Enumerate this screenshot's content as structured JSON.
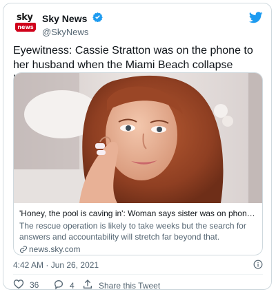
{
  "account": {
    "logo_top": "sky",
    "logo_bottom": "news",
    "display_name": "Sky News",
    "handle": "@SkyNews"
  },
  "tweet": {
    "text": "Eyewitness: Cassie Stratton was on the phone to her husband when the Miami Beach collapse happened",
    "timestamp": "4:42 AM · Jun 26, 2021"
  },
  "card": {
    "title": "'Honey, the pool is caving in': Woman says sister was on phone to husband…",
    "description": "The rescue operation is likely to take weeks but the search for answers and accountability will stretch far beyond that.",
    "domain": "news.sky.com"
  },
  "actions": {
    "likes": "36",
    "replies": "4",
    "share_label": "Share this Tweet"
  },
  "colors": {
    "accent": "#1d9bf0",
    "sky_red": "#d0021b",
    "muted": "#536471",
    "border": "#cfd9de"
  }
}
